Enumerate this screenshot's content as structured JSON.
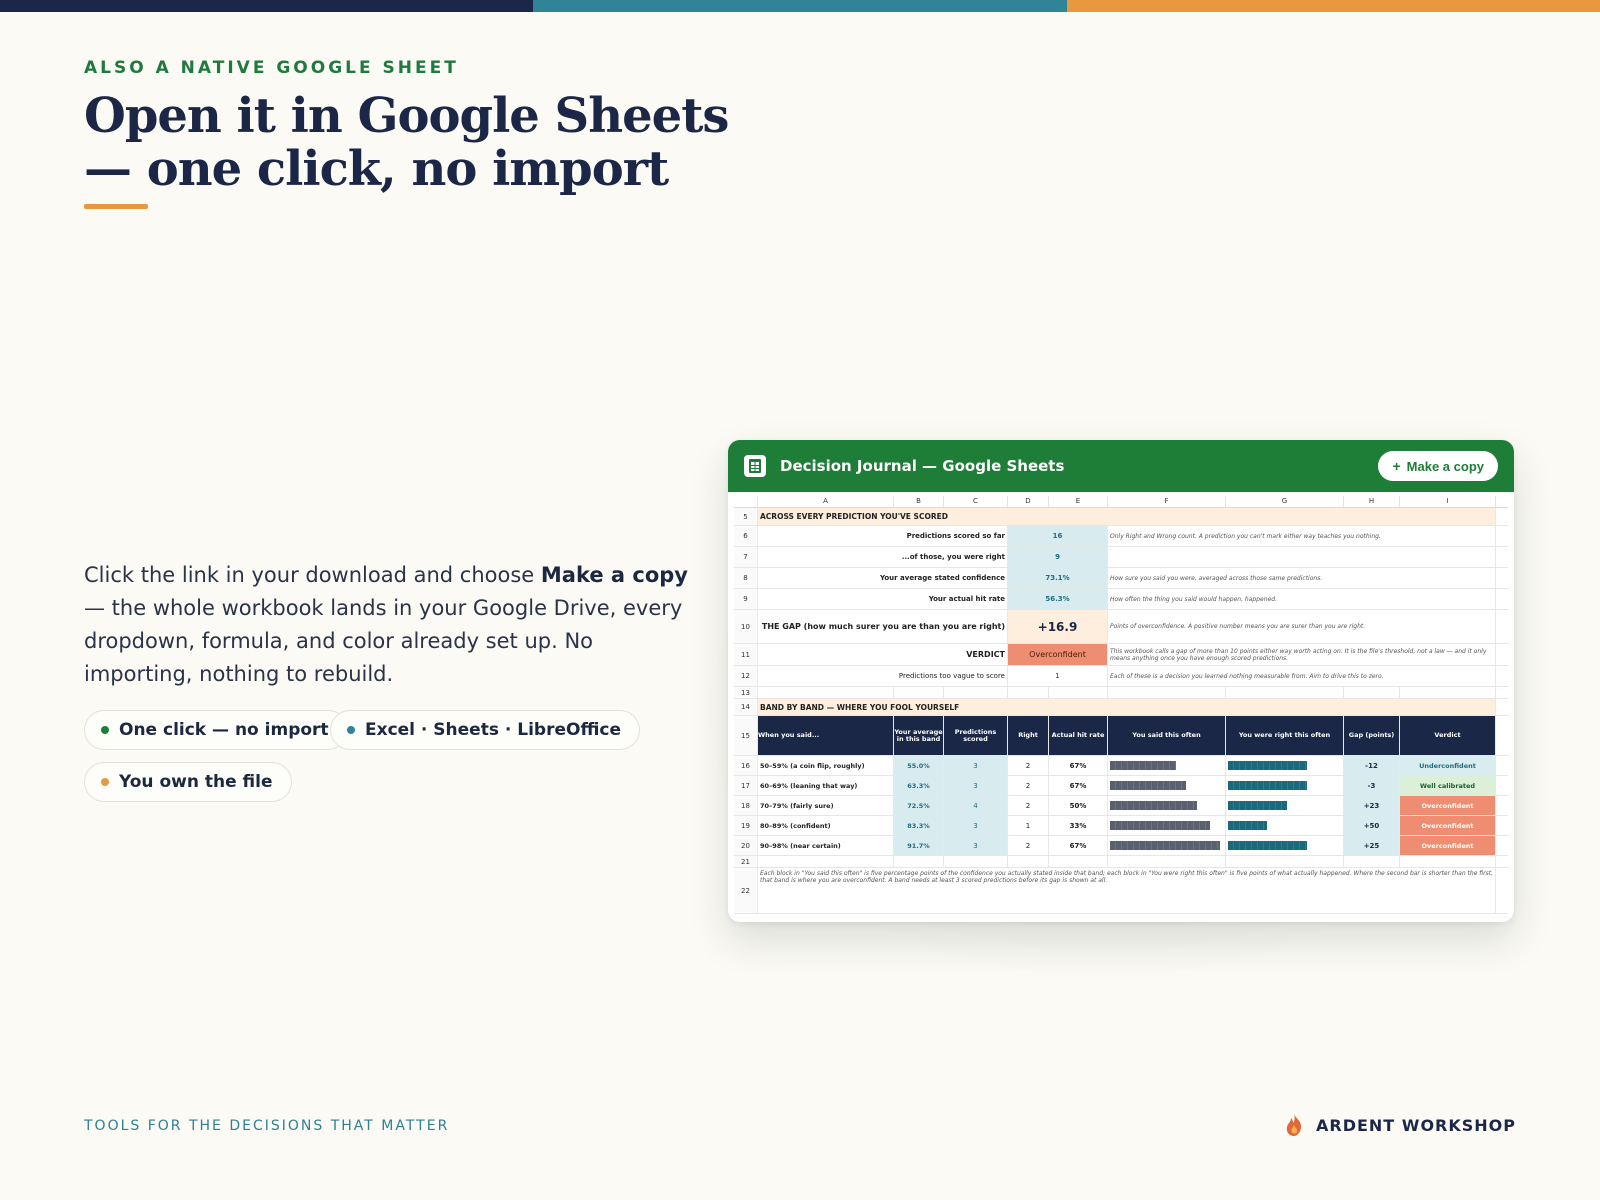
{
  "brand_colors": {
    "navy": "#1c2747",
    "teal": "#2f8497",
    "orange": "#e8983e",
    "green": "#1e7d37"
  },
  "eyebrow": "ALSO A NATIVE GOOGLE SHEET",
  "headline": {
    "line1": "Open it in Google Sheets",
    "line2": "— one click, no import"
  },
  "body": {
    "pre": "Click the link in your download and choose ",
    "bold": "Make a copy",
    "post": " — the whole workbook lands in your Google Drive, every dropdown, formula, and color already set up. No importing, nothing to rebuild."
  },
  "pills": [
    {
      "label": "One click — no import",
      "color": "#1e7d37"
    },
    {
      "label": "Excel · Sheets · LibreOffice",
      "color": "#2f8497"
    },
    {
      "label": "You own the file",
      "color": "#e8983e"
    }
  ],
  "sheet": {
    "title": "Decision Journal — Google Sheets",
    "icon": "sheets-grid-icon",
    "copy_button": "Make a copy",
    "columns": [
      "A",
      "B",
      "C",
      "D",
      "E",
      "F",
      "G",
      "H",
      "I"
    ],
    "section1": "ACROSS EVERY PREDICTION YOU'VE SCORED",
    "stats": [
      {
        "row": "6",
        "label": "Predictions scored so far",
        "value": "16",
        "note": "Only Right and Wrong count. A prediction you can't mark either way teaches you nothing."
      },
      {
        "row": "7",
        "label": "...of those, you were right",
        "value": "9",
        "note": ""
      },
      {
        "row": "8",
        "label": "Your average stated confidence",
        "value": "73.1%",
        "note": "How sure you said you were, averaged across those same predictions."
      },
      {
        "row": "9",
        "label": "Your actual hit rate",
        "value": "56.3%",
        "note": "How often the thing you said would happen, happened."
      }
    ],
    "gap": {
      "row": "10",
      "label": "THE GAP  (how much surer you are than you are right)",
      "value": "+16.9",
      "note": "Points of overconfidence. A positive number means you are surer than you are right."
    },
    "verdict": {
      "row": "11",
      "label": "VERDICT",
      "value": "Overconfident",
      "note": "This workbook calls a gap of more than 10 points either way worth acting on. It is the file's threshold, not a law — and it only means anything once you have enough scored predictions."
    },
    "vague": {
      "row": "12",
      "label": "Predictions too vague to score",
      "value": "1",
      "note": "Each of these is a decision you learned nothing measurable from. Aim to drive this to zero."
    },
    "section2": "BAND BY BAND — WHERE YOU FOOL YOURSELF",
    "band_headers": [
      "When you said...",
      "Your average in this band",
      "Predictions scored",
      "Right",
      "Actual hit rate",
      "You said this often",
      "You were right this often",
      "Gap (points)",
      "Verdict"
    ],
    "bands": [
      {
        "row": "16",
        "band": "50–59%  (a coin flip, roughly)",
        "avg": "55.0%",
        "scored": "3",
        "right": "2",
        "hit": "67%",
        "said": 0.55,
        "right_frac": 0.67,
        "gap": "-12",
        "verdict": "Underconfident",
        "vcolor": "#d9ecef",
        "vtext": "#1d6e81"
      },
      {
        "row": "17",
        "band": "60–69%  (leaning that way)",
        "avg": "63.3%",
        "scored": "3",
        "right": "2",
        "hit": "67%",
        "said": 0.633,
        "right_frac": 0.67,
        "gap": "-3",
        "verdict": "Well calibrated",
        "vcolor": "#dcefd8",
        "vtext": "#1e5e2c"
      },
      {
        "row": "18",
        "band": "70–79%  (fairly sure)",
        "avg": "72.5%",
        "scored": "4",
        "right": "2",
        "hit": "50%",
        "said": 0.725,
        "right_frac": 0.5,
        "gap": "+23",
        "verdict": "Overconfident",
        "vcolor": "#ef8d72",
        "vtext": "#ffffff"
      },
      {
        "row": "19",
        "band": "80–89%  (confident)",
        "avg": "83.3%",
        "scored": "3",
        "right": "1",
        "hit": "33%",
        "said": 0.833,
        "right_frac": 0.33,
        "gap": "+50",
        "verdict": "Overconfident",
        "vcolor": "#ef8d72",
        "vtext": "#ffffff"
      },
      {
        "row": "20",
        "band": "90–98%  (near certain)",
        "avg": "91.7%",
        "scored": "3",
        "right": "2",
        "hit": "67%",
        "said": 0.917,
        "right_frac": 0.67,
        "gap": "+25",
        "verdict": "Overconfident",
        "vcolor": "#ef8d72",
        "vtext": "#ffffff"
      }
    ],
    "footnote": "Each block in \"You said this often\" is five percentage points of the confidence you actually stated inside that band; each block in \"You were right this often\" is five points of what actually happened. Where the second bar is shorter than the first, that band is where you are overconfident. A band needs at least 3 scored predictions before its gap is shown at all.",
    "empty_rows": [
      "13",
      "21"
    ],
    "row_labels": {
      "section1": "5",
      "section2": "14",
      "bandhdr": "15",
      "footnote": "22"
    }
  },
  "footer": {
    "tagline": "TOOLS FOR THE DECISIONS THAT MATTER",
    "brand": "ARDENT WORKSHOP",
    "brand_icon": "flame-logo-icon"
  }
}
